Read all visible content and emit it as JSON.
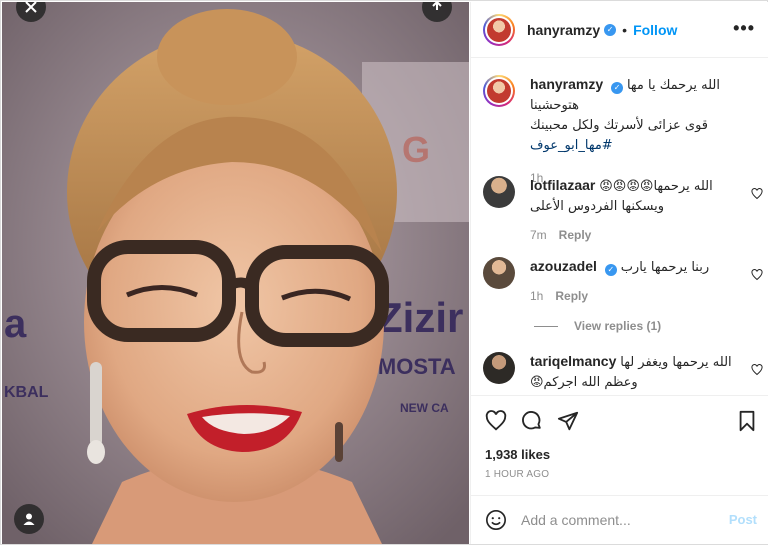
{
  "post": {
    "username": "hanyramzy",
    "follow_label": "Follow",
    "more_label": "•••",
    "separator": "•"
  },
  "caption": {
    "username": "hanyramzy",
    "text_line1": "الله يرحمك يا مها هتوحشينا",
    "text_line2": "قوى عزائى لأسرتك ولكل محبينك",
    "hashtag": "#مها_ابو_عوف",
    "time": "1h"
  },
  "comments": [
    {
      "username": "lotfilazaar",
      "text_line1": "الله يرحمها😡😡😡😡",
      "text_line2": "ويسكنها الفردوس الأعلى",
      "time": "7m",
      "reply_label": "Reply"
    },
    {
      "username": "azouzadel",
      "text": "ربنا يرحمها يارب",
      "time": "1h",
      "reply_label": "Reply",
      "verified": true
    },
    {
      "username": "tariqelmancy",
      "text_line1": "الله يرحمها ويغفر لها",
      "text_line2": "وعظم الله اجركم😡"
    }
  ],
  "view_replies_label": "View replies (1)",
  "likes_label": "1,938 likes",
  "time_ago_label": "1 HOUR AGO",
  "add_comment_placeholder": "Add a comment...",
  "post_button_label": "Post",
  "colors": {
    "link_blue": "#0095f6",
    "verified_blue": "#3897f0",
    "muted": "#8e8e8e"
  },
  "icons": [
    "close-icon",
    "share-icon",
    "user-tag-icon",
    "verified-icon",
    "more-icon",
    "heart-icon",
    "comment-icon",
    "send-icon",
    "bookmark-icon",
    "emoji-icon"
  ]
}
